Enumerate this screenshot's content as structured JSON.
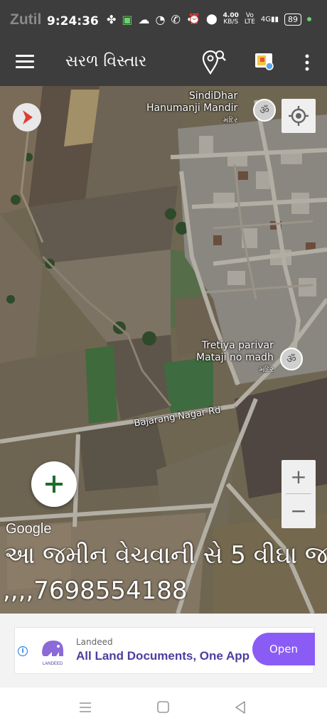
{
  "status_bar": {
    "watermark": "Zutil",
    "time": "9:24:36",
    "net_speed": "4.00\nKB/S",
    "net_speed_top": "4.00",
    "net_speed_unit": "KB/S",
    "volte": "Vo\nLTE",
    "signal": "4G",
    "battery": "89"
  },
  "app_bar": {
    "title": "સરળ વિસ્તાર"
  },
  "map": {
    "poi_1_name": "SindiDhar\nHanumanji Mandir",
    "poi_1_line1": "SindiDhar",
    "poi_1_line2": "Hanumanji Mandir",
    "poi_1_type": "મંદિર",
    "poi_2_line1": "Tretiya parivar",
    "poi_2_line2": "Mataji no madh",
    "poi_2_type": "મંદિર",
    "road_name": "Bajarang Nagar Rd",
    "attribution": "Google",
    "zoom_in": "+",
    "zoom_out": "−",
    "add_button": "+",
    "overlay_text": "આ જમીન વેચવાની સે 5 વીઘા જ",
    "overlay_phone": ",,,,7698554188"
  },
  "ad": {
    "logo_text": "LANDEED",
    "brand": "Landeed",
    "headline": "All Land Documents, One App",
    "cta": "Open",
    "info": "i"
  },
  "colors": {
    "app_bar": "#3d3d3d",
    "ad_cta": "#8a5cf5",
    "headline": "#4a3f9f"
  }
}
